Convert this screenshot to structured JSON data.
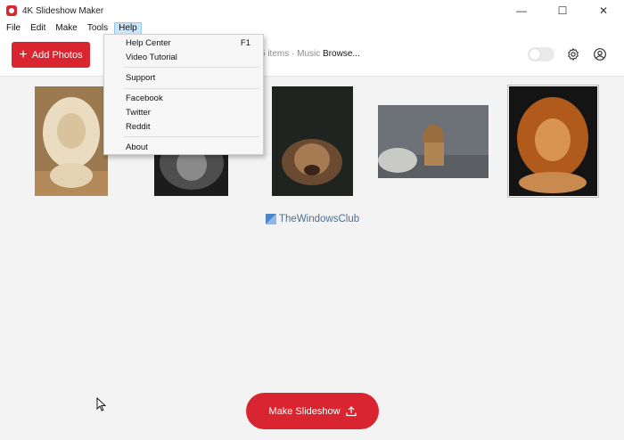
{
  "window": {
    "title": "4K Slideshow Maker",
    "minimize": "—",
    "maximize": "☐",
    "close": "✕"
  },
  "menubar": [
    "File",
    "Edit",
    "Make",
    "Tools",
    "Help"
  ],
  "help_menu": {
    "items": [
      {
        "label": "Help Center",
        "shortcut": "F1"
      },
      {
        "label": "Video Tutorial"
      },
      {
        "label": "Support"
      },
      {
        "label": "Facebook"
      },
      {
        "label": "Twitter"
      },
      {
        "label": "Reddit"
      },
      {
        "label": "About"
      }
    ]
  },
  "toolbar": {
    "add_photos": "Add Photos",
    "items_count": "5 items",
    "music_label": "· Music",
    "browse": "Browse...",
    "toggle_on": false
  },
  "photos": [
    {
      "name": "white-lion"
    },
    {
      "name": "black-white-lion"
    },
    {
      "name": "lion-on-dark"
    },
    {
      "name": "lion-on-rocks"
    },
    {
      "name": "orange-lion",
      "selected": true
    }
  ],
  "watermark": "TheWindowsClub",
  "make_slideshow": "Make Slideshow",
  "colors": {
    "accent": "#d9252f",
    "selection": "#f2c23a"
  }
}
